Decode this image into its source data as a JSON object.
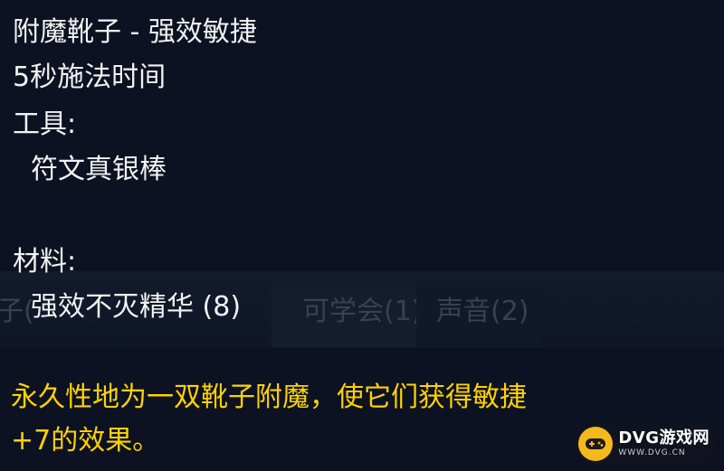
{
  "tooltip": {
    "title": "附魔靴子 - 强效敏捷",
    "cast_time": "5秒施法时间",
    "tools_header": "工具:",
    "tool_item": "符文真银棒",
    "materials_header": "材料:",
    "material_item": "强效不灭精华 (8)",
    "description_line1": "永久性地为一双靴子附魔，使它们获得敏捷",
    "description_line2": "+7的效果。"
  },
  "background_tabs": [
    {
      "label": "子("
    },
    {
      "label": "可学会(1)"
    },
    {
      "label": "声音(2)"
    }
  ],
  "watermark": {
    "brand": "DVG游戏网",
    "url": "WWW.DVG.CN",
    "icon": "gamepad-icon"
  },
  "colors": {
    "background": "#0c1222",
    "text": "#f2f2f2",
    "description": "#ffd200",
    "logo": "#f3b81b"
  }
}
